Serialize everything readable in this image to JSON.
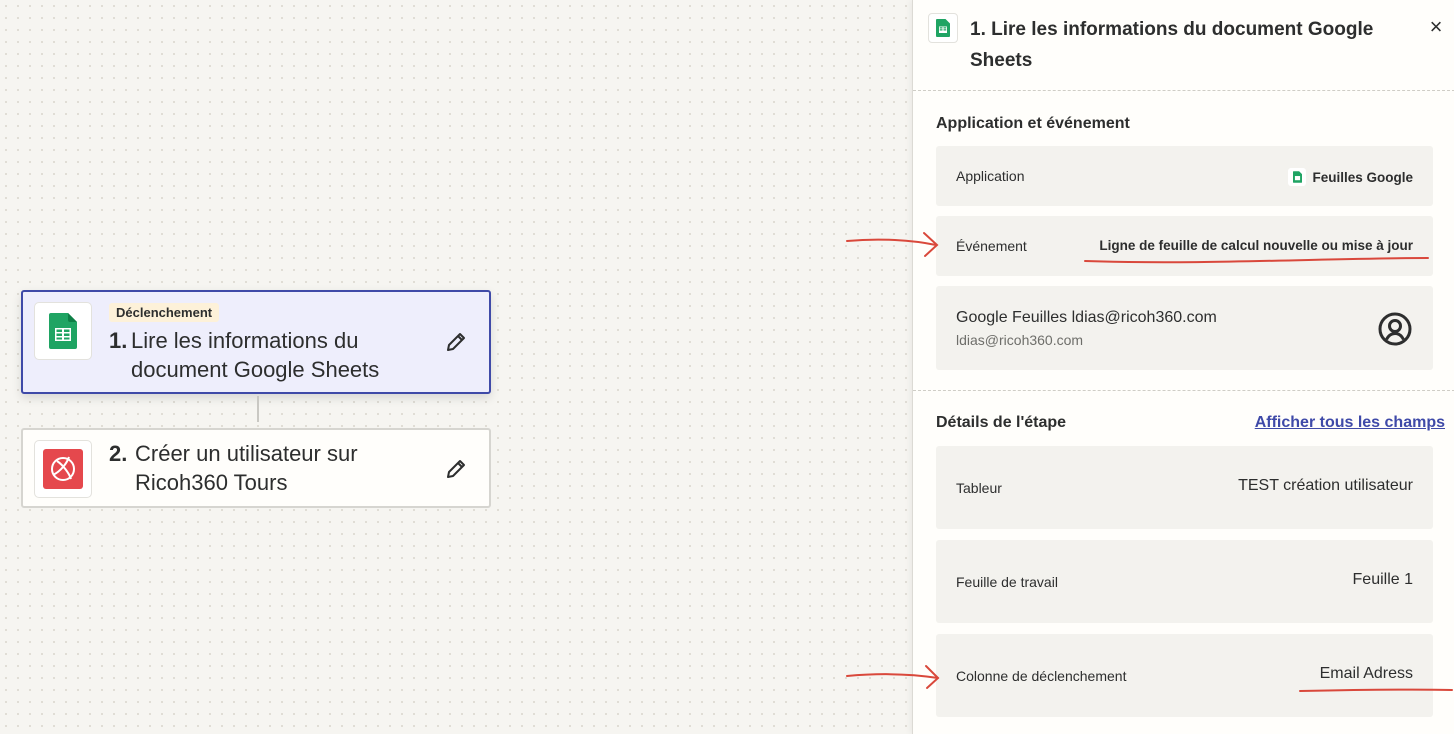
{
  "canvas": {
    "step1": {
      "badge": "Déclenchement",
      "number": "1.",
      "title": "Lire les informations du document Google Sheets"
    },
    "step2": {
      "number": "2.",
      "title": "Créer un utilisateur sur Ricoh360 Tours"
    }
  },
  "panel": {
    "number": "1.",
    "title": "Lire les informations du document Google Sheets",
    "close": "×",
    "app_event": {
      "heading": "Application et événement",
      "application_label": "Application",
      "application_value": "Feuilles Google",
      "event_label": "Événement",
      "event_value": "Ligne de feuille de calcul nouvelle ou mise à jour"
    },
    "account": {
      "name": "Google Feuilles ldias@ricoh360.com",
      "email": "ldias@ricoh360.com"
    },
    "details": {
      "heading": "Détails de l'étape",
      "show_all": "Afficher tous les champs",
      "fields": [
        {
          "label": "Tableur",
          "value": "TEST création utilisateur"
        },
        {
          "label": "Feuille de travail",
          "value": "Feuille 1"
        },
        {
          "label": "Colonne de déclenchement",
          "value": "Email Adress"
        }
      ]
    }
  },
  "colors": {
    "accent": "#3f4aa8",
    "sheets_green": "#1fa463",
    "ricoh_red": "#e5484d",
    "annotation": "#d9483b"
  },
  "icons": [
    "google-sheets-icon",
    "ricoh360-icon",
    "pencil-icon",
    "close-icon",
    "user-circle-icon"
  ]
}
